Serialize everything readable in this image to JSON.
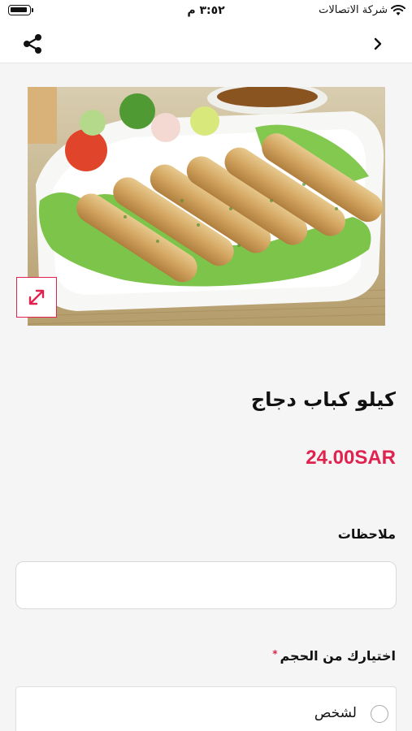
{
  "status_bar": {
    "time": "٣:٥٢ م",
    "carrier": "شركة الاتصالات"
  },
  "nav": {
    "share_icon": "share-icon",
    "back_icon": "chevron-right-icon"
  },
  "product": {
    "image_alt": "kebab-platter-photo",
    "name": "كيلو كباب دجاج",
    "price": "24.00SAR"
  },
  "notes": {
    "label": "ملاحظات",
    "value": "",
    "placeholder": ""
  },
  "size": {
    "label": "اختيارك من الحجم",
    "required_mark": "*",
    "options": [
      {
        "label": "لشخص",
        "selected": false
      }
    ]
  },
  "colors": {
    "accent": "#e0224f"
  }
}
